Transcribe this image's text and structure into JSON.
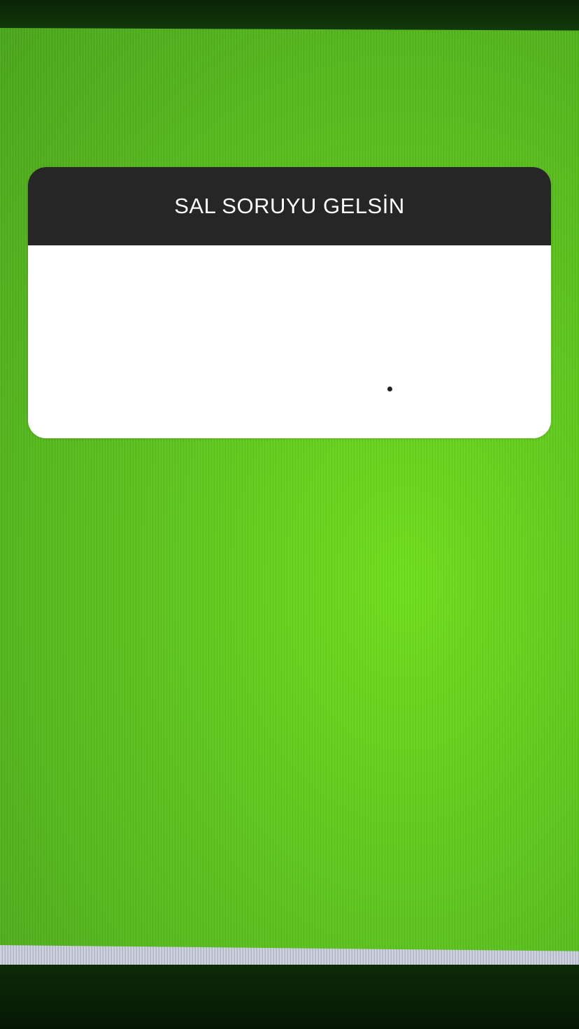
{
  "question_sticker": {
    "title": "SAL SORUYU GELSİN",
    "header_color": "#262626",
    "body_color": "#ffffff"
  },
  "background": {
    "primary_color": "#5cc51c",
    "bezel_color": "#0b2a08"
  }
}
